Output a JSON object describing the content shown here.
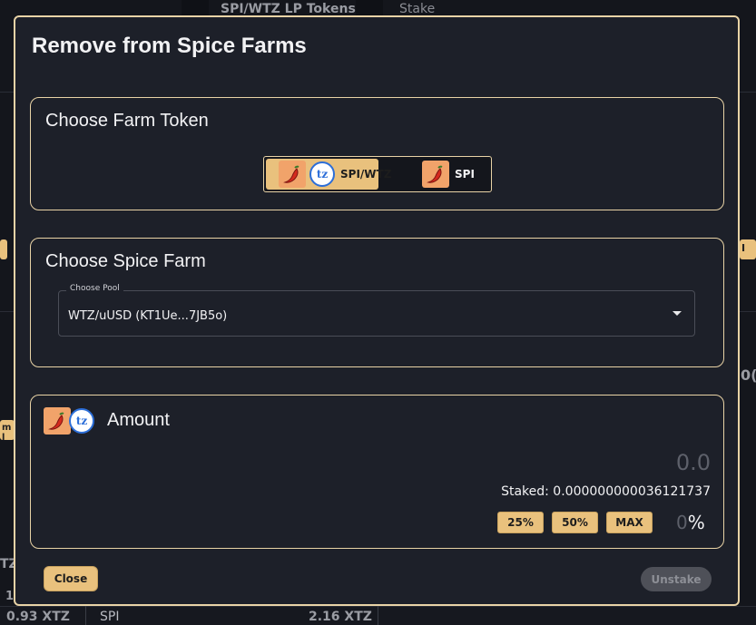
{
  "background": {
    "header_tokens": "SPI/WTZ LP Tokens",
    "header_stake": "Stake",
    "left_badge_1": "",
    "left_badge_2": "m l",
    "right_badge": "I",
    "right_edge_text": "0(",
    "left_edge_text": "TZ",
    "left_partial_value": "1",
    "bottom_left_value": "0.93 XTZ",
    "bottom_token": "SPI",
    "bottom_value": "2.16 XTZ"
  },
  "modal": {
    "title": "Remove from Spice Farms",
    "farm_token_section": {
      "title": "Choose Farm Token",
      "options": [
        {
          "label": "SPI/WTZ",
          "selected": true,
          "icons": [
            "chili-pepper-icon",
            "tezos-icon"
          ]
        },
        {
          "label": "SPI",
          "selected": false,
          "icons": [
            "chili-pepper-icon"
          ]
        }
      ]
    },
    "spice_farm_section": {
      "title": "Choose Spice Farm",
      "select_label": "Choose Pool",
      "select_value": "WTZ/uUSD (KT1Ue...7JB5o)"
    },
    "amount_section": {
      "title": "Amount",
      "value": "0.0",
      "staked_text": "Staked: 0.000000000036121737",
      "buttons": [
        "25%",
        "50%",
        "MAX"
      ],
      "percent_value": "0",
      "percent_sign": "%"
    },
    "close_label": "Close",
    "unstake_label": "Unstake"
  },
  "colors": {
    "accent": "#e9c17d",
    "border": "#e9d3a6",
    "modal_bg": "#1d2029",
    "tezos_blue": "#2c6ed8",
    "chili_bg": "#f1a36a"
  }
}
